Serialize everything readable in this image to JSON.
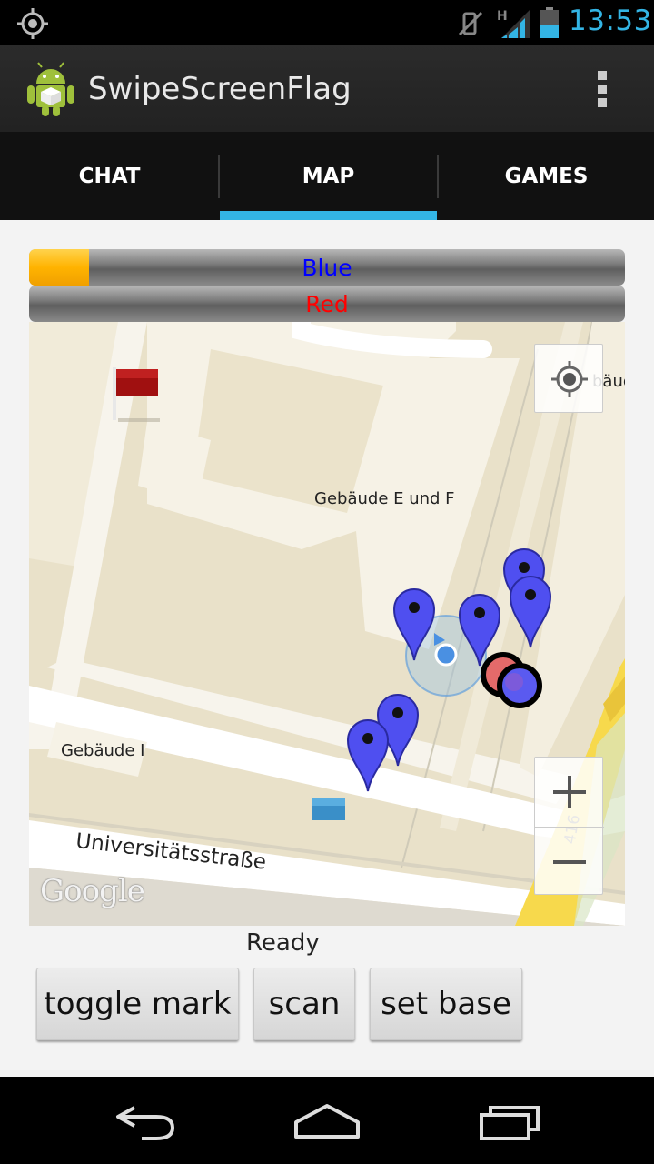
{
  "status_bar": {
    "time": "13:53",
    "icons": [
      "gps-icon",
      "mute-icon",
      "signal-icon",
      "battery-icon"
    ],
    "network_type": "H"
  },
  "action_bar": {
    "title": "SwipeScreenFlag",
    "app_icon": "android-icon",
    "overflow_icon": "overflow-menu-icon"
  },
  "tabs": [
    {
      "label": "CHAT",
      "selected": false
    },
    {
      "label": "MAP",
      "selected": true
    },
    {
      "label": "GAMES",
      "selected": false
    }
  ],
  "teams": [
    {
      "label": "Blue",
      "color": "#0000ff",
      "progress": 0.1
    },
    {
      "label": "Red",
      "color": "#ff0000",
      "progress": 0.0
    }
  ],
  "map": {
    "labels": {
      "building_ef": "Gebäude E und F",
      "building_i": "Gebäude I",
      "building_partial": "bäud",
      "street": "Universitätsstraße",
      "road_number": "416",
      "provider": "Google"
    },
    "controls": {
      "my_location_icon": "my-location-icon",
      "zoom_in": "+",
      "zoom_out": "−"
    },
    "colors": {
      "blue_marker": "#4f4ff0",
      "red_flag": "#a01010",
      "blue_flag": "#3a8fc8",
      "my_location": "#4a90e2"
    }
  },
  "status_text": "Ready",
  "buttons": {
    "toggle_mark": "toggle mark",
    "scan": "scan",
    "set_base": "set base"
  },
  "nav_bar": {
    "icons": [
      "back-icon",
      "home-icon",
      "recents-icon"
    ]
  }
}
